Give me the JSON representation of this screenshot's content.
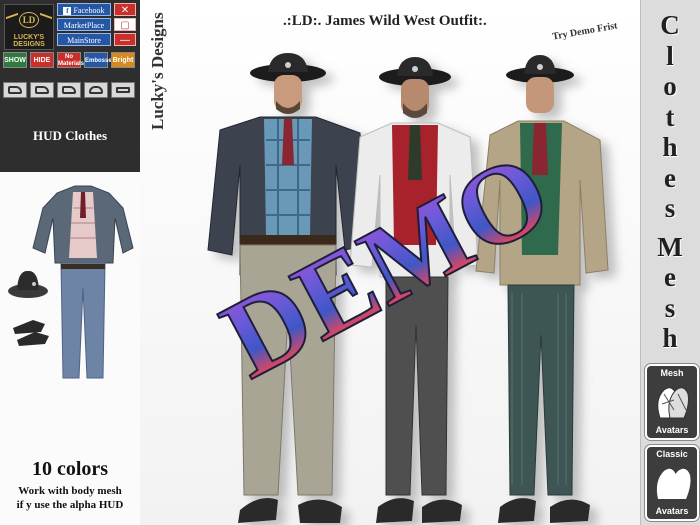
{
  "hud": {
    "logo_text": "LUCKY'S DESIGNS",
    "logo_mark": "LD",
    "links": {
      "facebook": "Facebook",
      "marketplace": "MarketPlace",
      "mainstore": "MainStore"
    },
    "controls": {
      "close": "✕",
      "minimize": "—"
    },
    "toggles": {
      "show": "SHOW",
      "hide": "HIDE",
      "no_materials": "No Materials",
      "embossed": "Embossed",
      "bright": "Bright"
    },
    "label": "HUD Clothes",
    "colors": {
      "facebook": "#2457a6",
      "close": "#c9302c",
      "show": "#2f7a3c",
      "hide": "#c9302c",
      "no_materials": "#c9302c",
      "embossed": "#2457a6",
      "bright": "#d68a1e"
    }
  },
  "left": {
    "colors_text": "10 colors",
    "note_line1": "Work with body mesh",
    "note_line2": "if y use the alpha HUD"
  },
  "main": {
    "brand": "Lucky's Designs",
    "title": ".:LD:. James Wild West Outfit:.",
    "try_demo": "Try Demo Frist",
    "watermark": "DEMO"
  },
  "right": {
    "letters": [
      "C",
      "l",
      "o",
      "t",
      "h",
      "e",
      "s",
      "M",
      "e",
      "s",
      "h"
    ],
    "badges": [
      {
        "top": "Mesh",
        "bottom": "Avatars"
      },
      {
        "top": "Classic",
        "bottom": "Avatars"
      }
    ]
  }
}
